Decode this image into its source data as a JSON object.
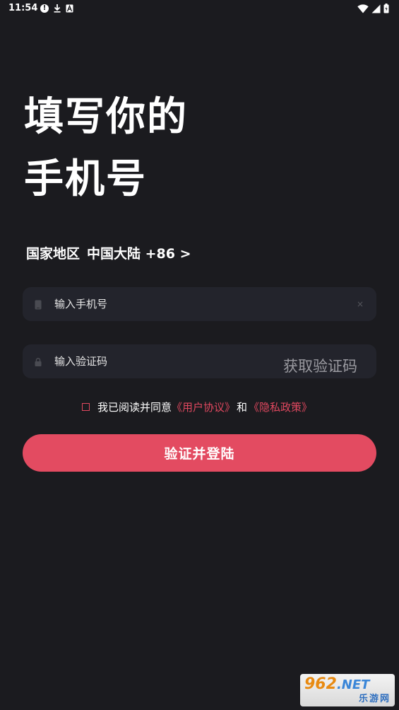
{
  "status_bar": {
    "time": "11:54",
    "left_icons": [
      "alert-icon",
      "download-icon",
      "a-icon"
    ],
    "right_icons": [
      "wifi-icon",
      "signal-icon",
      "battery-icon"
    ]
  },
  "title": {
    "line1": "填写你的",
    "line2": "手机号"
  },
  "region": {
    "label": "国家地区",
    "value": "中国大陆 +86 >"
  },
  "phone_field": {
    "placeholder": "输入手机号",
    "value": "",
    "clear_icon": "×"
  },
  "code_field": {
    "placeholder": "输入验证码",
    "value": "",
    "get_code_label": "获取验证码"
  },
  "agreement": {
    "checked": false,
    "prefix": "我已阅读并同意",
    "user_agreement": "《用户协议》",
    "and": "和",
    "privacy_policy": "《隐私政策》"
  },
  "submit": {
    "label": "验证并登陆"
  },
  "watermark": {
    "top_num": "962",
    "top_suffix": ".NET",
    "bottom": "乐游网"
  },
  "colors": {
    "background": "#1b1b1f",
    "field_background": "#23242c",
    "accent": "#e34b61",
    "link": "#e0485f"
  }
}
